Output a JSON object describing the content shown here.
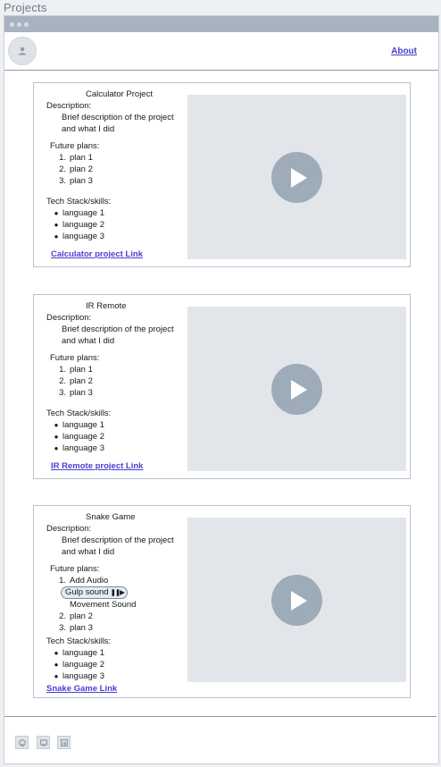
{
  "page": {
    "title": "Projects"
  },
  "nav": {
    "about_label": "About"
  },
  "labels": {
    "description": "Description:",
    "future_plans": "Future plans:",
    "tech_stack": "Tech Stack/skills:"
  },
  "projects": [
    {
      "title": "Calculator Project",
      "description": "Brief description of the project and what I did",
      "plans": [
        {
          "num": "1.",
          "text": "plan 1"
        },
        {
          "num": "2.",
          "text": "plan 2"
        },
        {
          "num": "3.",
          "text": "plan 3"
        }
      ],
      "skills": [
        "language 1",
        "language 2",
        "language 3"
      ],
      "link": "Calculator project Link"
    },
    {
      "title": "IR Remote",
      "description": "Brief description of the project and what I did",
      "plans": [
        {
          "num": "1.",
          "text": "plan 1"
        },
        {
          "num": "2.",
          "text": "plan 2"
        },
        {
          "num": "3.",
          "text": "plan 3"
        }
      ],
      "skills": [
        "language 1",
        "language 2",
        "language 3"
      ],
      "link": "IR Remote project Link"
    },
    {
      "title": "Snake Game",
      "description": "Brief description of the project and what I did",
      "plans": [
        {
          "num": "1.",
          "text": "Add Audio"
        },
        {
          "num": "2.",
          "text": "plan 2"
        },
        {
          "num": "3.",
          "text": "plan 3"
        }
      ],
      "audio": {
        "pill_label": "Gulp sound",
        "pill_controls": "❚❚▶",
        "sub_item": "Movement Sound"
      },
      "skills": [
        "language 1",
        "language 2",
        "language 3"
      ],
      "link": "Snake Game Link"
    }
  ],
  "footer": {
    "icons": [
      "github-icon",
      "portfolio-icon",
      "linkedin-icon"
    ]
  },
  "colors": {
    "link": "#4b3fd1",
    "play_button": "#9eabb9",
    "video_bg": "#e2e6ea",
    "titlebar": "#a7b3c0"
  }
}
